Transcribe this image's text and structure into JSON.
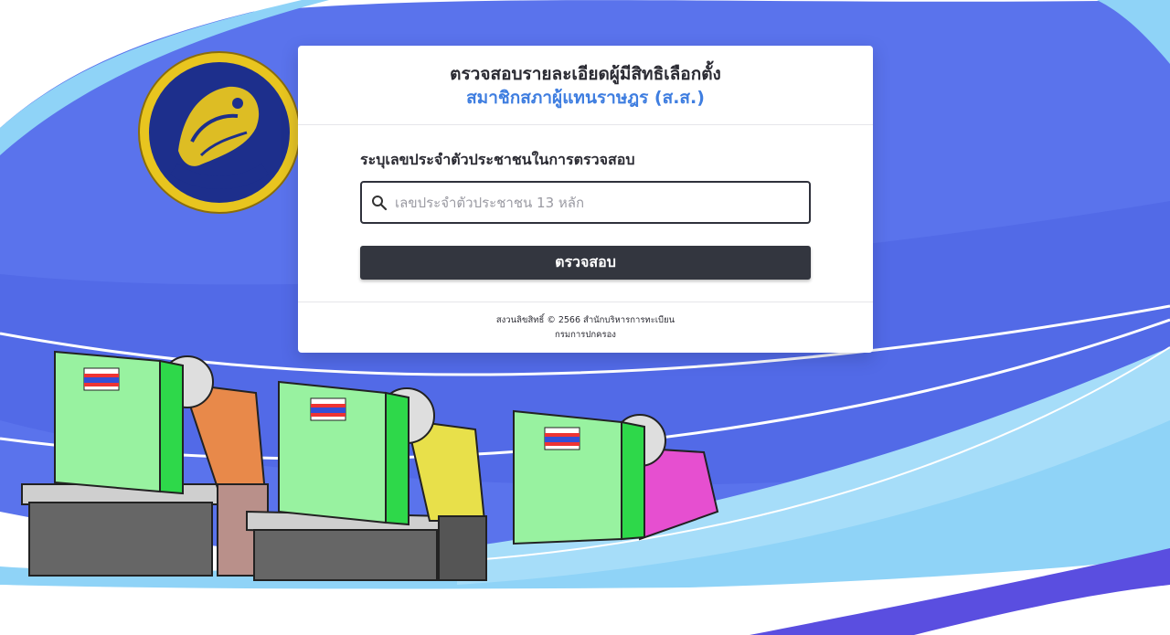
{
  "header": {
    "title": "ตรวจสอบรายละเอียดผู้มีสิทธิเลือกตั้ง",
    "subtitle": "สมาชิกสภาผู้แทนราษฎร (ส.ส.)"
  },
  "form": {
    "label": "ระบุเลขประจำตัวประชาชนในการตรวจสอบ",
    "placeholder": "เลขประจำตัวประชาชน 13 หลัก",
    "value": "",
    "submit_label": "ตรวจสอบ",
    "search_icon": "search-icon"
  },
  "footer": {
    "copyright": "สงวนลิขสิทธิ์ © 2566 สำนักบริหารการทะเบียน",
    "org": "กรมการปกครอง"
  },
  "emblem": {
    "text": "กรมการปกครอง",
    "icon": "department-emblem"
  },
  "colors": {
    "background_blue": "#4f6ee6",
    "light_blue": "#8fd3f7",
    "accent_blue": "#3f7ee0",
    "button_dark": "#33363f",
    "booth_green": "#98f2a0",
    "booth_green_dark": "#2ed84a"
  }
}
